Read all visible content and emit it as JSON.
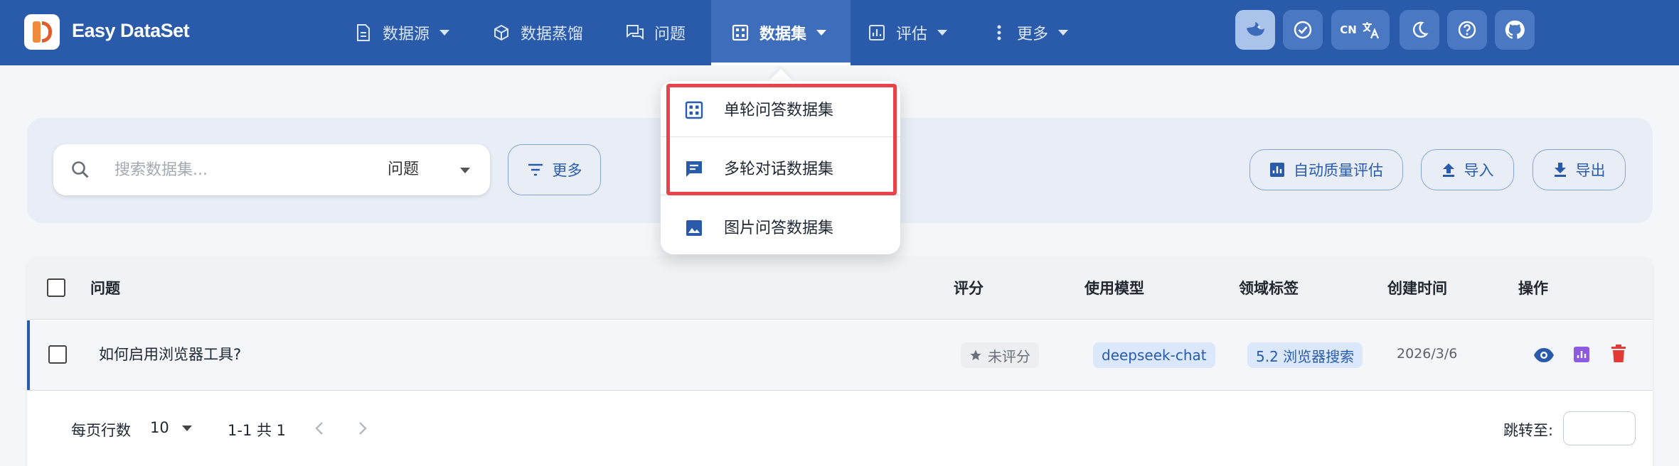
{
  "app": {
    "title": "Easy DataSet"
  },
  "nav": [
    {
      "label": "数据源",
      "icon": "file-icon",
      "has_caret": true
    },
    {
      "label": "数据蒸馏",
      "icon": "cube-icon",
      "has_caret": false
    },
    {
      "label": "问题",
      "icon": "chat-icon",
      "has_caret": false
    },
    {
      "label": "数据集",
      "icon": "grid-icon",
      "has_caret": true,
      "active": true
    },
    {
      "label": "评估",
      "icon": "bar-chart-icon",
      "has_caret": true
    },
    {
      "label": "更多",
      "icon": "more-vertical-icon",
      "has_caret": true
    }
  ],
  "toolbar_buttons": {
    "lang": "CN"
  },
  "search": {
    "placeholder": "搜索数据集...",
    "field_value": "问题"
  },
  "actions": {
    "more_label": "更多",
    "auto_eval_label": "自动质量评估",
    "import_label": "导入",
    "export_label": "导出"
  },
  "table": {
    "headers": {
      "question": "问题",
      "score": "评分",
      "model": "使用模型",
      "tag": "领域标签",
      "created": "创建时间",
      "ops": "操作"
    },
    "rows": [
      {
        "question": "如何启用浏览器工具?",
        "score": "未评分",
        "model": "deepseek-chat",
        "tag": "5.2 浏览器搜索",
        "created": "2026/3/6"
      }
    ]
  },
  "pagination": {
    "rows_per_page_label": "每页行数",
    "rows_per_page": "10",
    "range": "1-1 共 1",
    "jump_label": "跳转至:"
  },
  "dropdown": {
    "items": [
      {
        "label": "单轮问答数据集",
        "icon": "grid-icon"
      },
      {
        "label": "多轮对话数据集",
        "icon": "chat-bubble-icon"
      },
      {
        "label": "图片问答数据集",
        "icon": "image-icon"
      }
    ]
  },
  "colors": {
    "topbar": "#2a5bab",
    "accent": "#2a5bab",
    "highlight": "#e8424a",
    "delete": "#e53935",
    "chart_icon": "#8e5be0"
  }
}
